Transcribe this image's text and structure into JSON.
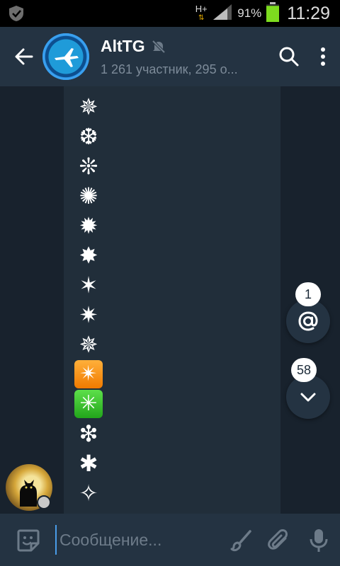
{
  "status_bar": {
    "network": "H+",
    "battery_percent": "91%",
    "battery_level": 0.91,
    "time": "11:29",
    "icons": [
      "shield-icon",
      "network-arrows-icon",
      "signal-icon",
      "battery-icon"
    ]
  },
  "header": {
    "title": "AltTG",
    "subtitle": "1 261 участник, 295 о...",
    "icons": [
      "back-arrow-icon",
      "channel-avatar",
      "muted-icon",
      "search-icon",
      "more-vert-icon"
    ]
  },
  "message": {
    "glyphs": [
      {
        "char": "✵",
        "style": "plain"
      },
      {
        "char": "❆",
        "style": "plain"
      },
      {
        "char": "❊",
        "style": "plain"
      },
      {
        "char": "✺",
        "style": "plain"
      },
      {
        "char": "✹",
        "style": "plain"
      },
      {
        "char": "✸",
        "style": "plain"
      },
      {
        "char": "✶",
        "style": "plain"
      },
      {
        "char": "✷",
        "style": "plain"
      },
      {
        "char": "✵",
        "style": "plain"
      },
      {
        "char": "✴",
        "style": "orange"
      },
      {
        "char": "✳",
        "style": "green"
      },
      {
        "char": "❇",
        "style": "plain"
      },
      {
        "char": "✱",
        "style": "plain"
      },
      {
        "char": "✧",
        "style": "plain"
      }
    ]
  },
  "fabs": {
    "mention_count": "1",
    "unread_count": "58"
  },
  "composer": {
    "placeholder": "Сообщение...",
    "value": ""
  },
  "colors": {
    "header_bg": "#243342",
    "chat_bg": "#18222d",
    "bubble_bg": "#212e3a",
    "accent": "#4a9ce8"
  }
}
